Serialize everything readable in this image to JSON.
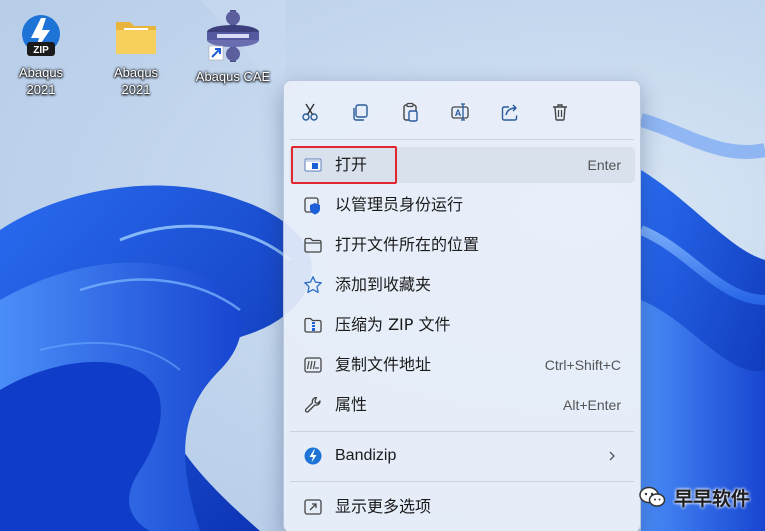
{
  "desktop": {
    "icons": [
      {
        "label_line1": "Abaqus",
        "label_line2": "2021",
        "icon": "zip-archive-icon"
      },
      {
        "label_line1": "Abaqus",
        "label_line2": "2021",
        "icon": "folder-icon"
      },
      {
        "label_line1": "Abaqus CAE",
        "label_line2": "",
        "icon": "abaqus-app-shortcut-icon"
      }
    ]
  },
  "context_menu": {
    "toolbar": [
      {
        "name": "cut",
        "icon": "scissors-icon"
      },
      {
        "name": "copy",
        "icon": "copy-icon"
      },
      {
        "name": "paste",
        "icon": "paste-icon"
      },
      {
        "name": "rename",
        "icon": "rename-icon"
      },
      {
        "name": "share",
        "icon": "share-icon"
      },
      {
        "name": "delete",
        "icon": "trash-icon"
      }
    ],
    "items": [
      {
        "label": "打开",
        "accelerator": "Enter",
        "icon": "open-app-icon"
      },
      {
        "label": "以管理员身份运行",
        "accelerator": "",
        "icon": "admin-shield-icon"
      },
      {
        "label": "打开文件所在的位置",
        "accelerator": "",
        "icon": "folder-outline-icon"
      },
      {
        "label": "添加到收藏夹",
        "accelerator": "",
        "icon": "star-icon"
      },
      {
        "label": "压缩为 ZIP 文件",
        "accelerator": "",
        "icon": "zip-folder-icon"
      },
      {
        "label": "复制文件地址",
        "accelerator": "Ctrl+Shift+C",
        "icon": "copy-path-icon"
      },
      {
        "label": "属性",
        "accelerator": "Alt+Enter",
        "icon": "wrench-icon"
      },
      {
        "label": "Bandizip",
        "accelerator": "",
        "icon": "bandizip-icon"
      },
      {
        "label": "显示更多选项",
        "accelerator": "",
        "icon": "more-options-icon"
      }
    ]
  },
  "watermark": {
    "text": "早早软件",
    "icon": "wechat-icon"
  },
  "colors": {
    "accent": "#0067c0",
    "highlight_box": "#e0262e"
  }
}
